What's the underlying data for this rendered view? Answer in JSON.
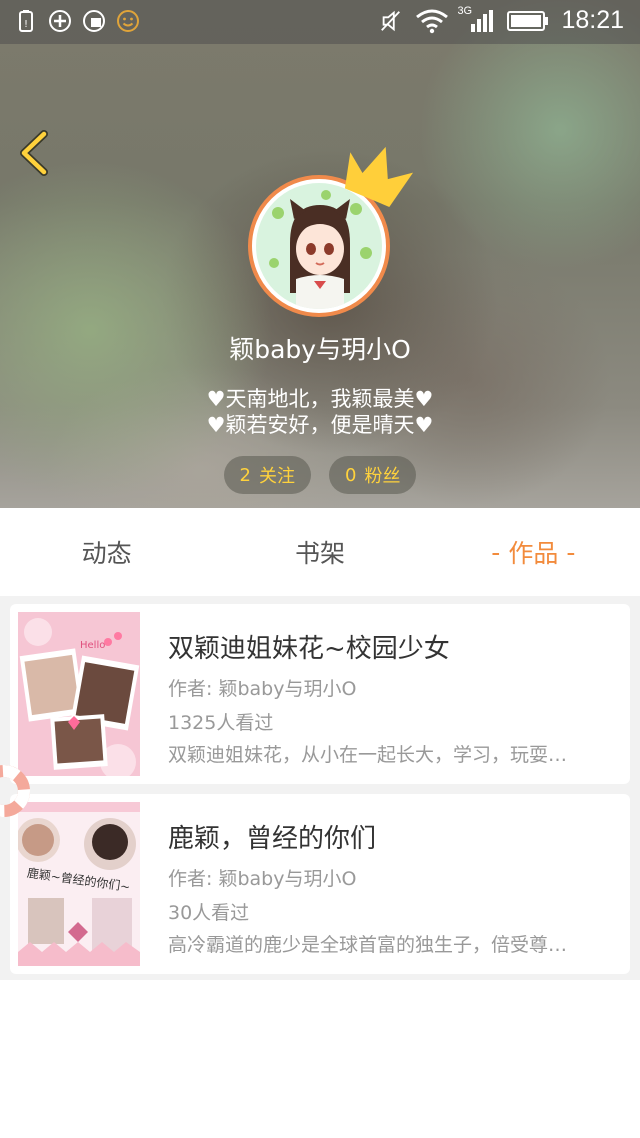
{
  "status_bar": {
    "time": "18:21",
    "network": "3G"
  },
  "profile": {
    "username": "颖baby与玥小O",
    "bio_line1": "♥天南地北，我颖最美♥",
    "bio_line2": "♥颖若安好，便是晴天♥",
    "following_count": "2",
    "following_label": "关注",
    "followers_count": "0",
    "followers_label": "粉丝"
  },
  "tabs": [
    {
      "label": "动态"
    },
    {
      "label": "书架"
    },
    {
      "label": "作品",
      "active": true,
      "prefix": "-",
      "suffix": "-"
    }
  ],
  "works": [
    {
      "title": "双颖迪姐妹花~校园少女",
      "author": "作者: 颖baby与玥小O",
      "views": "1325人看过",
      "description": "双颖迪姐妹花，从小在一起长大，学习，玩耍…",
      "cover_text": "Hello"
    },
    {
      "title": "鹿颖，曾经的你们",
      "author": "作者: 颖baby与玥小O",
      "views": "30人看过",
      "description": "高冷霸道的鹿少是全球首富的独生子，倍受尊…",
      "cover_text": "鹿颖~曾经的你们~"
    }
  ],
  "colors": {
    "accent": "#f28b3c",
    "stat_text": "#ffd23c",
    "avatar_border": "#f08a4b"
  }
}
